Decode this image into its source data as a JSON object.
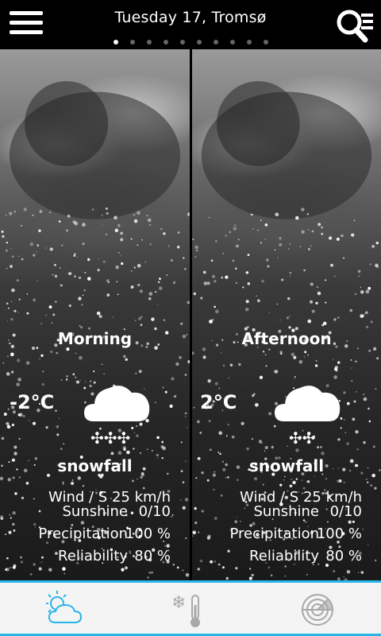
{
  "header": {
    "title": "Tuesday 17, Tromsø",
    "page_count": 10,
    "active_page": 0
  },
  "forecast": [
    {
      "period": "Morning",
      "temperature": "-2°C",
      "condition": "snowfall",
      "icon": "snow-cloud-icon",
      "flakes": 3,
      "wind_label": "Wind / S 25 km/h",
      "rows": [
        {
          "label": "Sunshine",
          "value": "0/10"
        },
        {
          "label": "Precipitation",
          "value": "100 %"
        },
        {
          "label": "Reliability",
          "value": "80 %"
        }
      ]
    },
    {
      "period": "Afternoon",
      "temperature": "2°C",
      "condition": "snowfall",
      "icon": "snow-cloud-icon",
      "flakes": 2,
      "wind_label": "Wind / S 25 km/h",
      "rows": [
        {
          "label": "Sunshine",
          "value": "0/10"
        },
        {
          "label": "Precipitation",
          "value": "100 %"
        },
        {
          "label": "Reliability",
          "value": "80 %"
        }
      ]
    }
  ],
  "tabs": [
    {
      "icon": "weather-forecast-icon",
      "active": true
    },
    {
      "icon": "snow-thermometer-icon",
      "active": false
    },
    {
      "icon": "radar-icon",
      "active": false
    }
  ],
  "colors": {
    "accent": "#28b6e8",
    "tab_inactive": "#a8a8a8"
  }
}
